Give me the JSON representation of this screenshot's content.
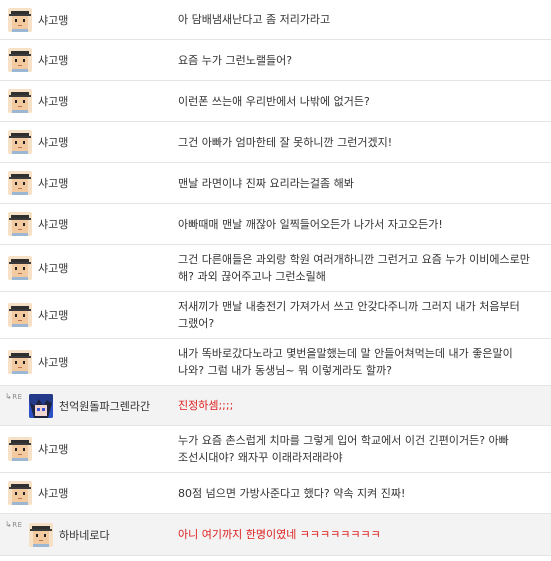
{
  "comments": [
    {
      "nick": "샤고맹",
      "text": "아 담배냄새난다고 좀 저리가라고",
      "reply": false,
      "avatar": "pixel-face"
    },
    {
      "nick": "샤고맹",
      "text": "요즘 누가 그런노랠들어?",
      "reply": false,
      "avatar": "pixel-face"
    },
    {
      "nick": "샤고맹",
      "text": "이런폰 쓰는애 우리반에서 나밖에 없거든?",
      "reply": false,
      "avatar": "pixel-face"
    },
    {
      "nick": "샤고맹",
      "text": "그건 아빠가 엄마한테 잘 못하니깐 그런거겠지!",
      "reply": false,
      "avatar": "pixel-face"
    },
    {
      "nick": "샤고맹",
      "text": "맨날 라면이냐 진짜 요리라는걸좀 해봐",
      "reply": false,
      "avatar": "pixel-face"
    },
    {
      "nick": "샤고맹",
      "text": "아빠때매 맨날 깨잖아 일찍들어오든가 나가서 자고오든가!",
      "reply": false,
      "avatar": "pixel-face"
    },
    {
      "nick": "샤고맹",
      "text": "그건 다른애들은 과외랑 학원 여러개하니깐 그런거고 요즘 누가 이비에스로만 해? 과외 끊어주고나 그런소릴해",
      "reply": false,
      "avatar": "pixel-face"
    },
    {
      "nick": "샤고맹",
      "text": "저새끼가 맨날 내충전기 가져가서 쓰고 안갖다주니까 그러지 내가 처음부터 그랬어?",
      "reply": false,
      "avatar": "pixel-face"
    },
    {
      "nick": "샤고맹",
      "text": "내가 똑바로갔다노라고 몇번을말했는데 말 안들어쳐먹는데 내가 좋은말이 나와? 그럼 내가 동생님~ 뭐 이렇게라도 할까?",
      "reply": false,
      "avatar": "pixel-face"
    },
    {
      "nick": "천억원돌파그렌라간",
      "text": "진정하셈;;;;",
      "reply": true,
      "re": "RE",
      "red": true,
      "avatar": "anime-face"
    },
    {
      "nick": "샤고맹",
      "text": "누가 요즘 촌스럽게 치마를 그렇게 입어 학교에서 이건 긴편이거든? 아빠 조선시대야? 왜자꾸 이래라저래라야",
      "reply": false,
      "avatar": "pixel-face"
    },
    {
      "nick": "샤고맹",
      "text": "80점 넘으면 가방사준다고 했다? 약속 지켜 진짜!",
      "reply": false,
      "avatar": "pixel-face"
    },
    {
      "nick": "하바네로다",
      "text": "아니 여기까지 한명이였네 ㅋㅋㅋㅋㅋㅋㅋㅋ",
      "reply": true,
      "re": "RE",
      "red": true,
      "avatar": "pixel-face"
    }
  ],
  "colors": {
    "red": "#dd1f1f",
    "text": "#333333",
    "reply_bg": "#f3f3f3",
    "divider": "#e4e4e4"
  }
}
